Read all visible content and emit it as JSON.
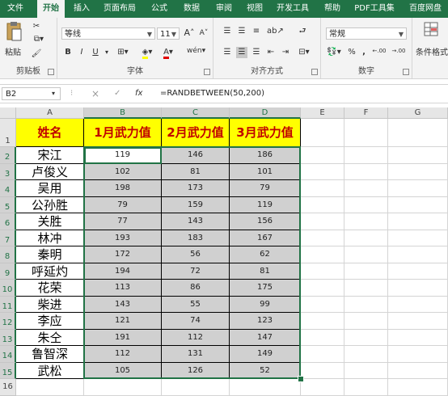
{
  "tabs": [
    "文件",
    "开始",
    "插入",
    "页面布局",
    "公式",
    "数据",
    "审阅",
    "视图",
    "开发工具",
    "帮助",
    "PDF工具集",
    "百度网盘"
  ],
  "active_tab": "开始",
  "ribbon": {
    "clipboard": {
      "paste_label": "粘贴",
      "group_label": "剪贴板"
    },
    "font": {
      "font_name": "等线",
      "font_size": "11",
      "bold": "B",
      "italic": "I",
      "underline": "U",
      "group_label": "字体",
      "increase": "A",
      "decrease": "A",
      "wen": "wén"
    },
    "alignment": {
      "group_label": "对齐方式"
    },
    "number": {
      "format": "常规",
      "percent": "%",
      "comma": ",",
      "inc_dec": ".00",
      "dec_dec": ".00",
      "group_label": "数字"
    },
    "styles": {
      "cond_format_label": "条件格式"
    }
  },
  "formula_bar": {
    "name_box": "B2",
    "fx": "fx",
    "formula": "=RANDBETWEEN(50,200)",
    "cancel": "×",
    "enter": "✓"
  },
  "sheet": {
    "columns": [
      "A",
      "B",
      "C",
      "D",
      "E",
      "F",
      "G"
    ],
    "headers": [
      "姓名",
      "1月武力值",
      "2月武力值",
      "3月武力值"
    ],
    "rows": [
      {
        "name": "宋江",
        "b": "119",
        "c": "146",
        "d": "186"
      },
      {
        "name": "卢俊义",
        "b": "102",
        "c": "81",
        "d": "101"
      },
      {
        "name": "吴用",
        "b": "198",
        "c": "173",
        "d": "79"
      },
      {
        "name": "公孙胜",
        "b": "79",
        "c": "159",
        "d": "119"
      },
      {
        "name": "关胜",
        "b": "77",
        "c": "143",
        "d": "156"
      },
      {
        "name": "林冲",
        "b": "193",
        "c": "183",
        "d": "167"
      },
      {
        "name": "秦明",
        "b": "172",
        "c": "56",
        "d": "62"
      },
      {
        "name": "呼延灼",
        "b": "194",
        "c": "72",
        "d": "81"
      },
      {
        "name": "花荣",
        "b": "113",
        "c": "86",
        "d": "175"
      },
      {
        "name": "柴进",
        "b": "143",
        "c": "55",
        "d": "99"
      },
      {
        "name": "李应",
        "b": "121",
        "c": "74",
        "d": "123"
      },
      {
        "name": "朱仝",
        "b": "191",
        "c": "112",
        "d": "147"
      },
      {
        "name": "鲁智深",
        "b": "112",
        "c": "131",
        "d": "149"
      },
      {
        "name": "武松",
        "b": "105",
        "c": "126",
        "d": "52"
      }
    ],
    "row_numbers": [
      "1",
      "2",
      "3",
      "4",
      "5",
      "6",
      "7",
      "8",
      "9",
      "10",
      "11",
      "12",
      "13",
      "14",
      "15",
      "16"
    ]
  },
  "colors": {
    "accent": "#217346",
    "header_fill": "#ffff00",
    "header_text": "#c00000",
    "selection": "#d0d0d0"
  }
}
